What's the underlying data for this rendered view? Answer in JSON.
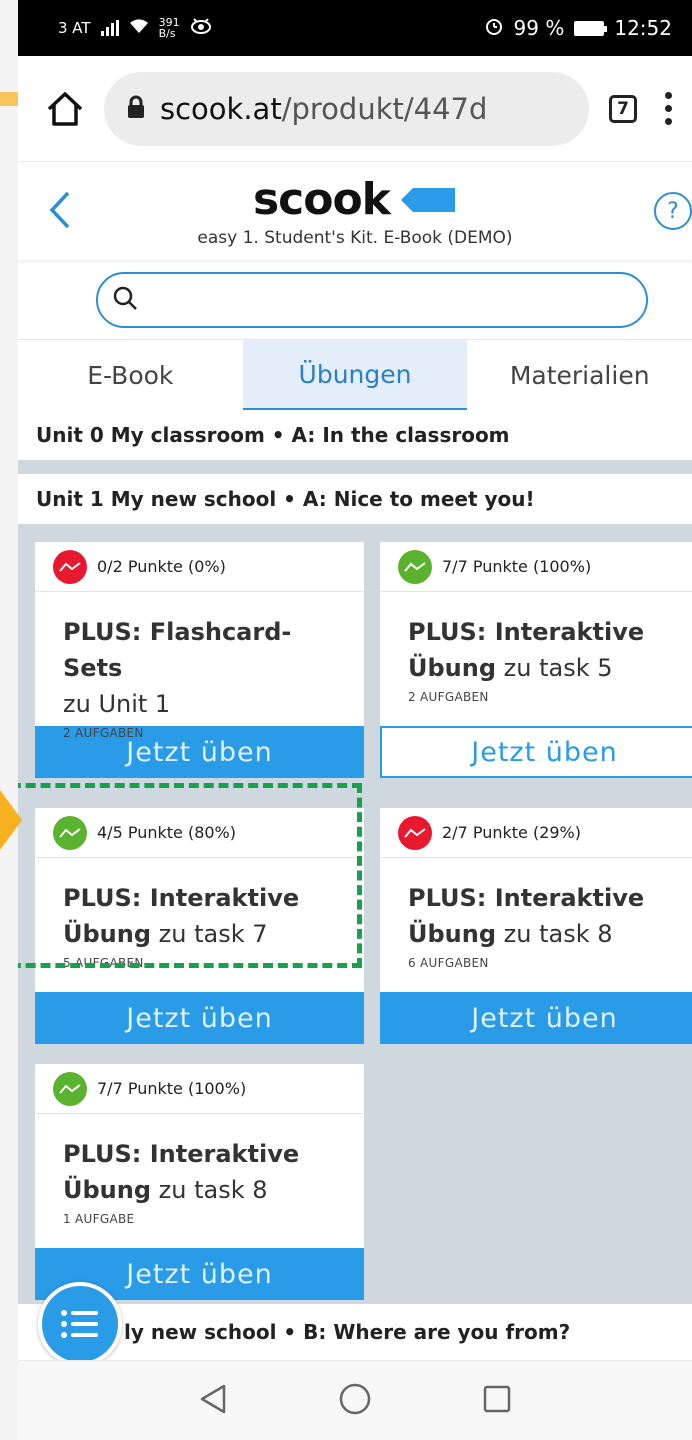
{
  "status_bar": {
    "carrier": "3 AT",
    "net_speed_value": "391",
    "net_speed_unit": "B/s",
    "battery": "99 %",
    "time": "12:52"
  },
  "browser": {
    "url_domain": "scook.at",
    "url_path": "/produkt/447d",
    "tab_count": "7"
  },
  "app_header": {
    "logo": "scook",
    "subtitle": "easy 1. Student's Kit. E-Book (DEMO)",
    "help": "?"
  },
  "search": {
    "value": "",
    "placeholder": ""
  },
  "tabs": [
    {
      "label": "E-Book",
      "active": false
    },
    {
      "label": "Übungen",
      "active": true
    },
    {
      "label": "Materialien",
      "active": false
    }
  ],
  "units": [
    {
      "title": "Unit 0 My classroom • A: In the classroom"
    },
    {
      "title": "Unit 1 My new school • A: Nice to meet you!"
    }
  ],
  "cards": [
    {
      "status": "red",
      "score": "0/2 Punkte (0%)",
      "title_bold": "PLUS: Flashcard-Sets",
      "title_rest": "zu Unit 1",
      "count": "2 AUFGABEN",
      "button": "Jetzt üben",
      "button_style": "filled"
    },
    {
      "status": "green",
      "score": "7/7 Punkte (100%)",
      "title_bold": "PLUS: Interaktive Übung",
      "title_rest": "zu task 5",
      "count": "2 AUFGABEN",
      "button": "Jetzt üben",
      "button_style": "outline"
    },
    {
      "status": "green",
      "score": "4/5 Punkte (80%)",
      "title_bold": "PLUS: Interaktive Übung",
      "title_rest": "zu task 7",
      "count": "5 AUFGABEN",
      "button": "Jetzt üben",
      "button_style": "filled"
    },
    {
      "status": "red",
      "score": "2/7 Punkte (29%)",
      "title_bold": "PLUS: Interaktive Übung",
      "title_rest": "zu task 8",
      "count": "6 AUFGABEN",
      "button": "Jetzt üben",
      "button_style": "filled"
    },
    {
      "status": "green",
      "score": "7/7 Punkte (100%)",
      "title_bold": "PLUS: Interaktive Übung",
      "title_rest": "zu task 8",
      "count": "1 AUFGABE",
      "button": "Jetzt üben",
      "button_style": "filled"
    }
  ],
  "next_unit": "ly new school • B: Where are you from?",
  "colors": {
    "accent": "#2a9be6",
    "status_red": "#e6192e",
    "status_green": "#5bb22f",
    "highlight": "#18a04d",
    "pointer": "#f6b21e"
  }
}
